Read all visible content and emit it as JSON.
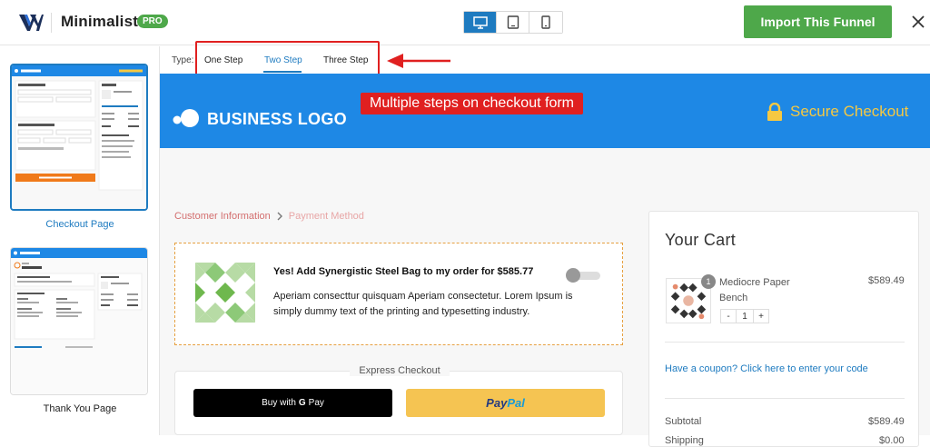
{
  "app": {
    "brand": "Minimalist",
    "badge": "PRO",
    "import_label": "Import This Funnel",
    "accent": "#1e7bc0",
    "green": "#4ea84a"
  },
  "device_toggle": [
    {
      "icon": "desktop-icon",
      "active": true
    },
    {
      "icon": "tablet-icon",
      "active": false
    },
    {
      "icon": "mobile-icon",
      "active": false
    }
  ],
  "sidebar": {
    "pages": [
      {
        "label": "Checkout Page",
        "active": true
      },
      {
        "label": "Thank You Page",
        "active": false
      }
    ]
  },
  "type_selector": {
    "label": "Type:",
    "options": [
      "One Step",
      "Two Step",
      "Three Step"
    ],
    "selected": "Two Step"
  },
  "annotation": {
    "text": "Multiple steps on checkout form"
  },
  "preview": {
    "business_logo": "BUSINESS LOGO",
    "secure_checkout": "Secure Checkout",
    "breadcrumb": [
      "Customer Information",
      "Payment Method"
    ],
    "offer": {
      "title": "Yes! Add Synergistic Steel Bag to my order for $585.77",
      "description": "Aperiam consecttur quisquam Aperiam consectetur. Lorem Ipsum is simply dummy text of the printing and typesetting industry."
    },
    "express": {
      "title": "Express Checkout",
      "gpay_prefix": "Buy with",
      "gpay_g": "G",
      "gpay_pay": "Pay",
      "paypal_pay": "Pay",
      "paypal_pal": "Pal"
    },
    "cart": {
      "title": "Your Cart",
      "item_name": "Mediocre Paper Bench",
      "item_price": "$589.49",
      "item_qty": "1",
      "qty_minus": "-",
      "qty_plus": "+",
      "coupon_text": "Have a coupon? Click here to enter your code",
      "subtotal_label": "Subtotal",
      "subtotal_value": "$589.49",
      "next_label": "Shipping",
      "next_value": "$0.00"
    }
  }
}
